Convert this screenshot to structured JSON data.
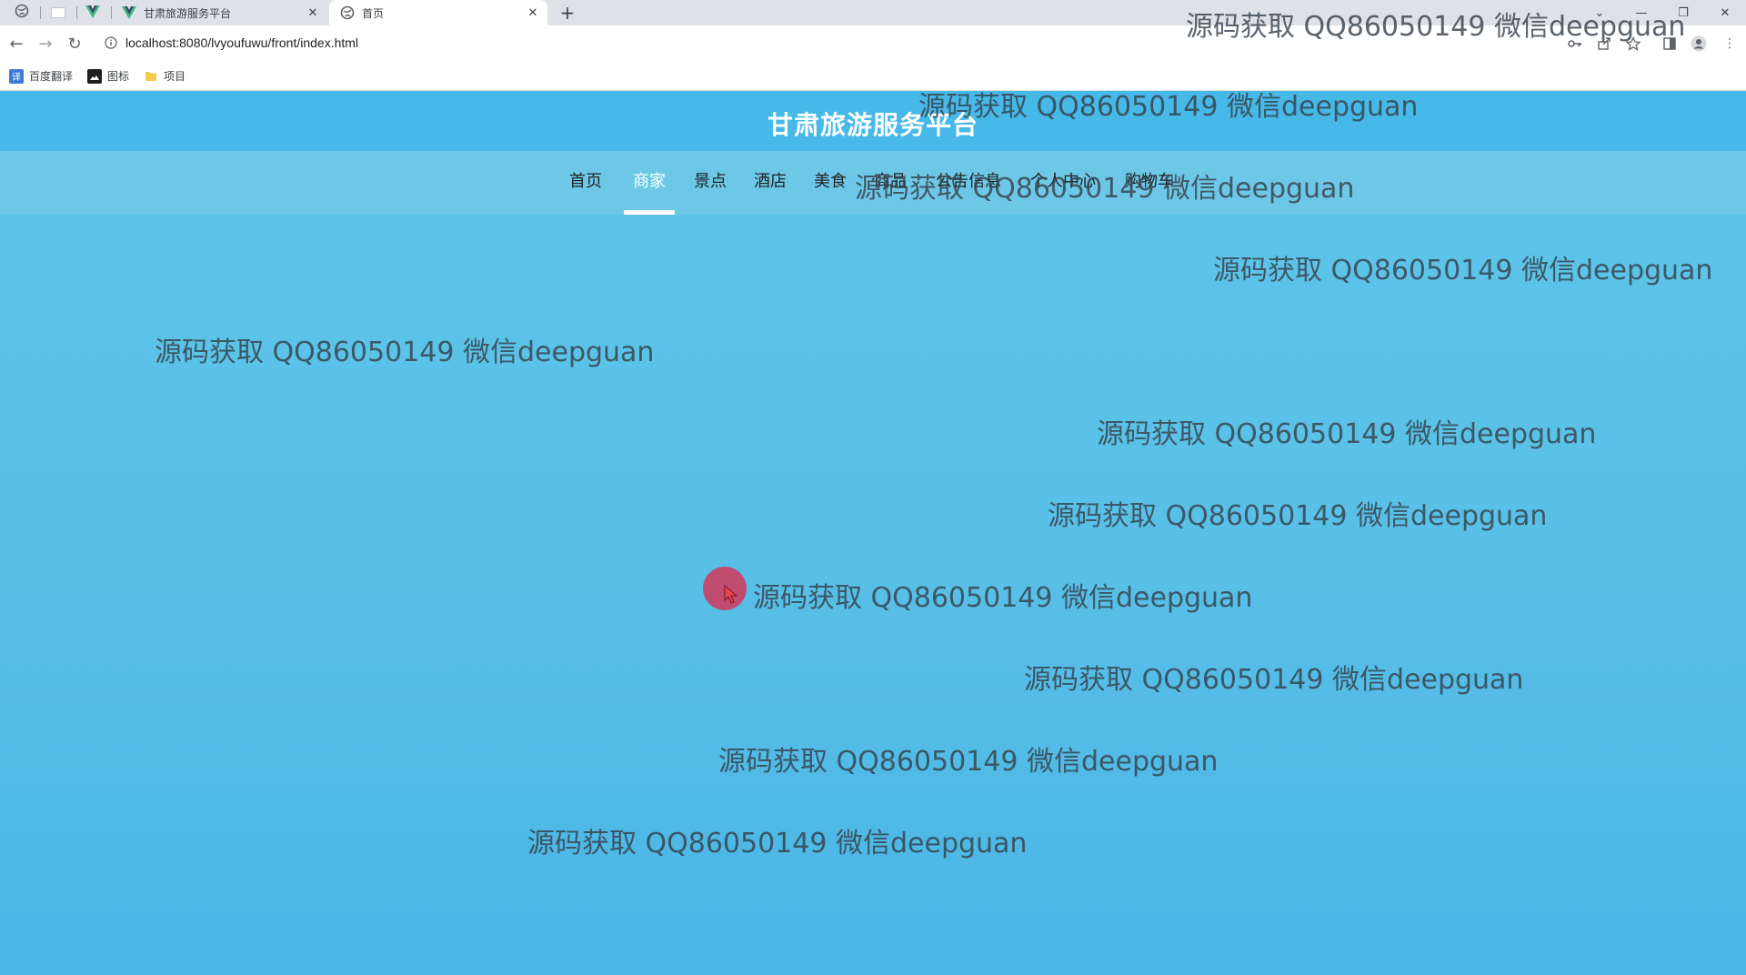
{
  "browser": {
    "tabs": [
      {
        "title": "甘肃旅游服务平台",
        "active": false
      },
      {
        "title": "首页",
        "active": true
      }
    ],
    "new_tab_label": "+",
    "url": "localhost:8080/lvyoufuwu/front/index.html",
    "bookmarks": [
      {
        "label": "百度翻译",
        "icon": "translate-icon"
      },
      {
        "label": "图标",
        "icon": "image-icon"
      },
      {
        "label": "项目",
        "icon": "folder-icon"
      }
    ]
  },
  "site": {
    "title": "甘肃旅游服务平台",
    "nav": [
      "首页",
      "商家",
      "景点",
      "酒店",
      "美食",
      "商品",
      "公告信息",
      "个人中心",
      "购物车"
    ],
    "active_nav": "商家"
  },
  "watermark": {
    "text": "源码获取 QQ86050149 微信deepguan",
    "count": 11
  },
  "colors": {
    "header": "#46b9e8",
    "nav_bar": "#6dc8e8",
    "page_background": "#58bfe7",
    "title_text": "#ffffff",
    "cursor_highlight": "#d2375a"
  }
}
